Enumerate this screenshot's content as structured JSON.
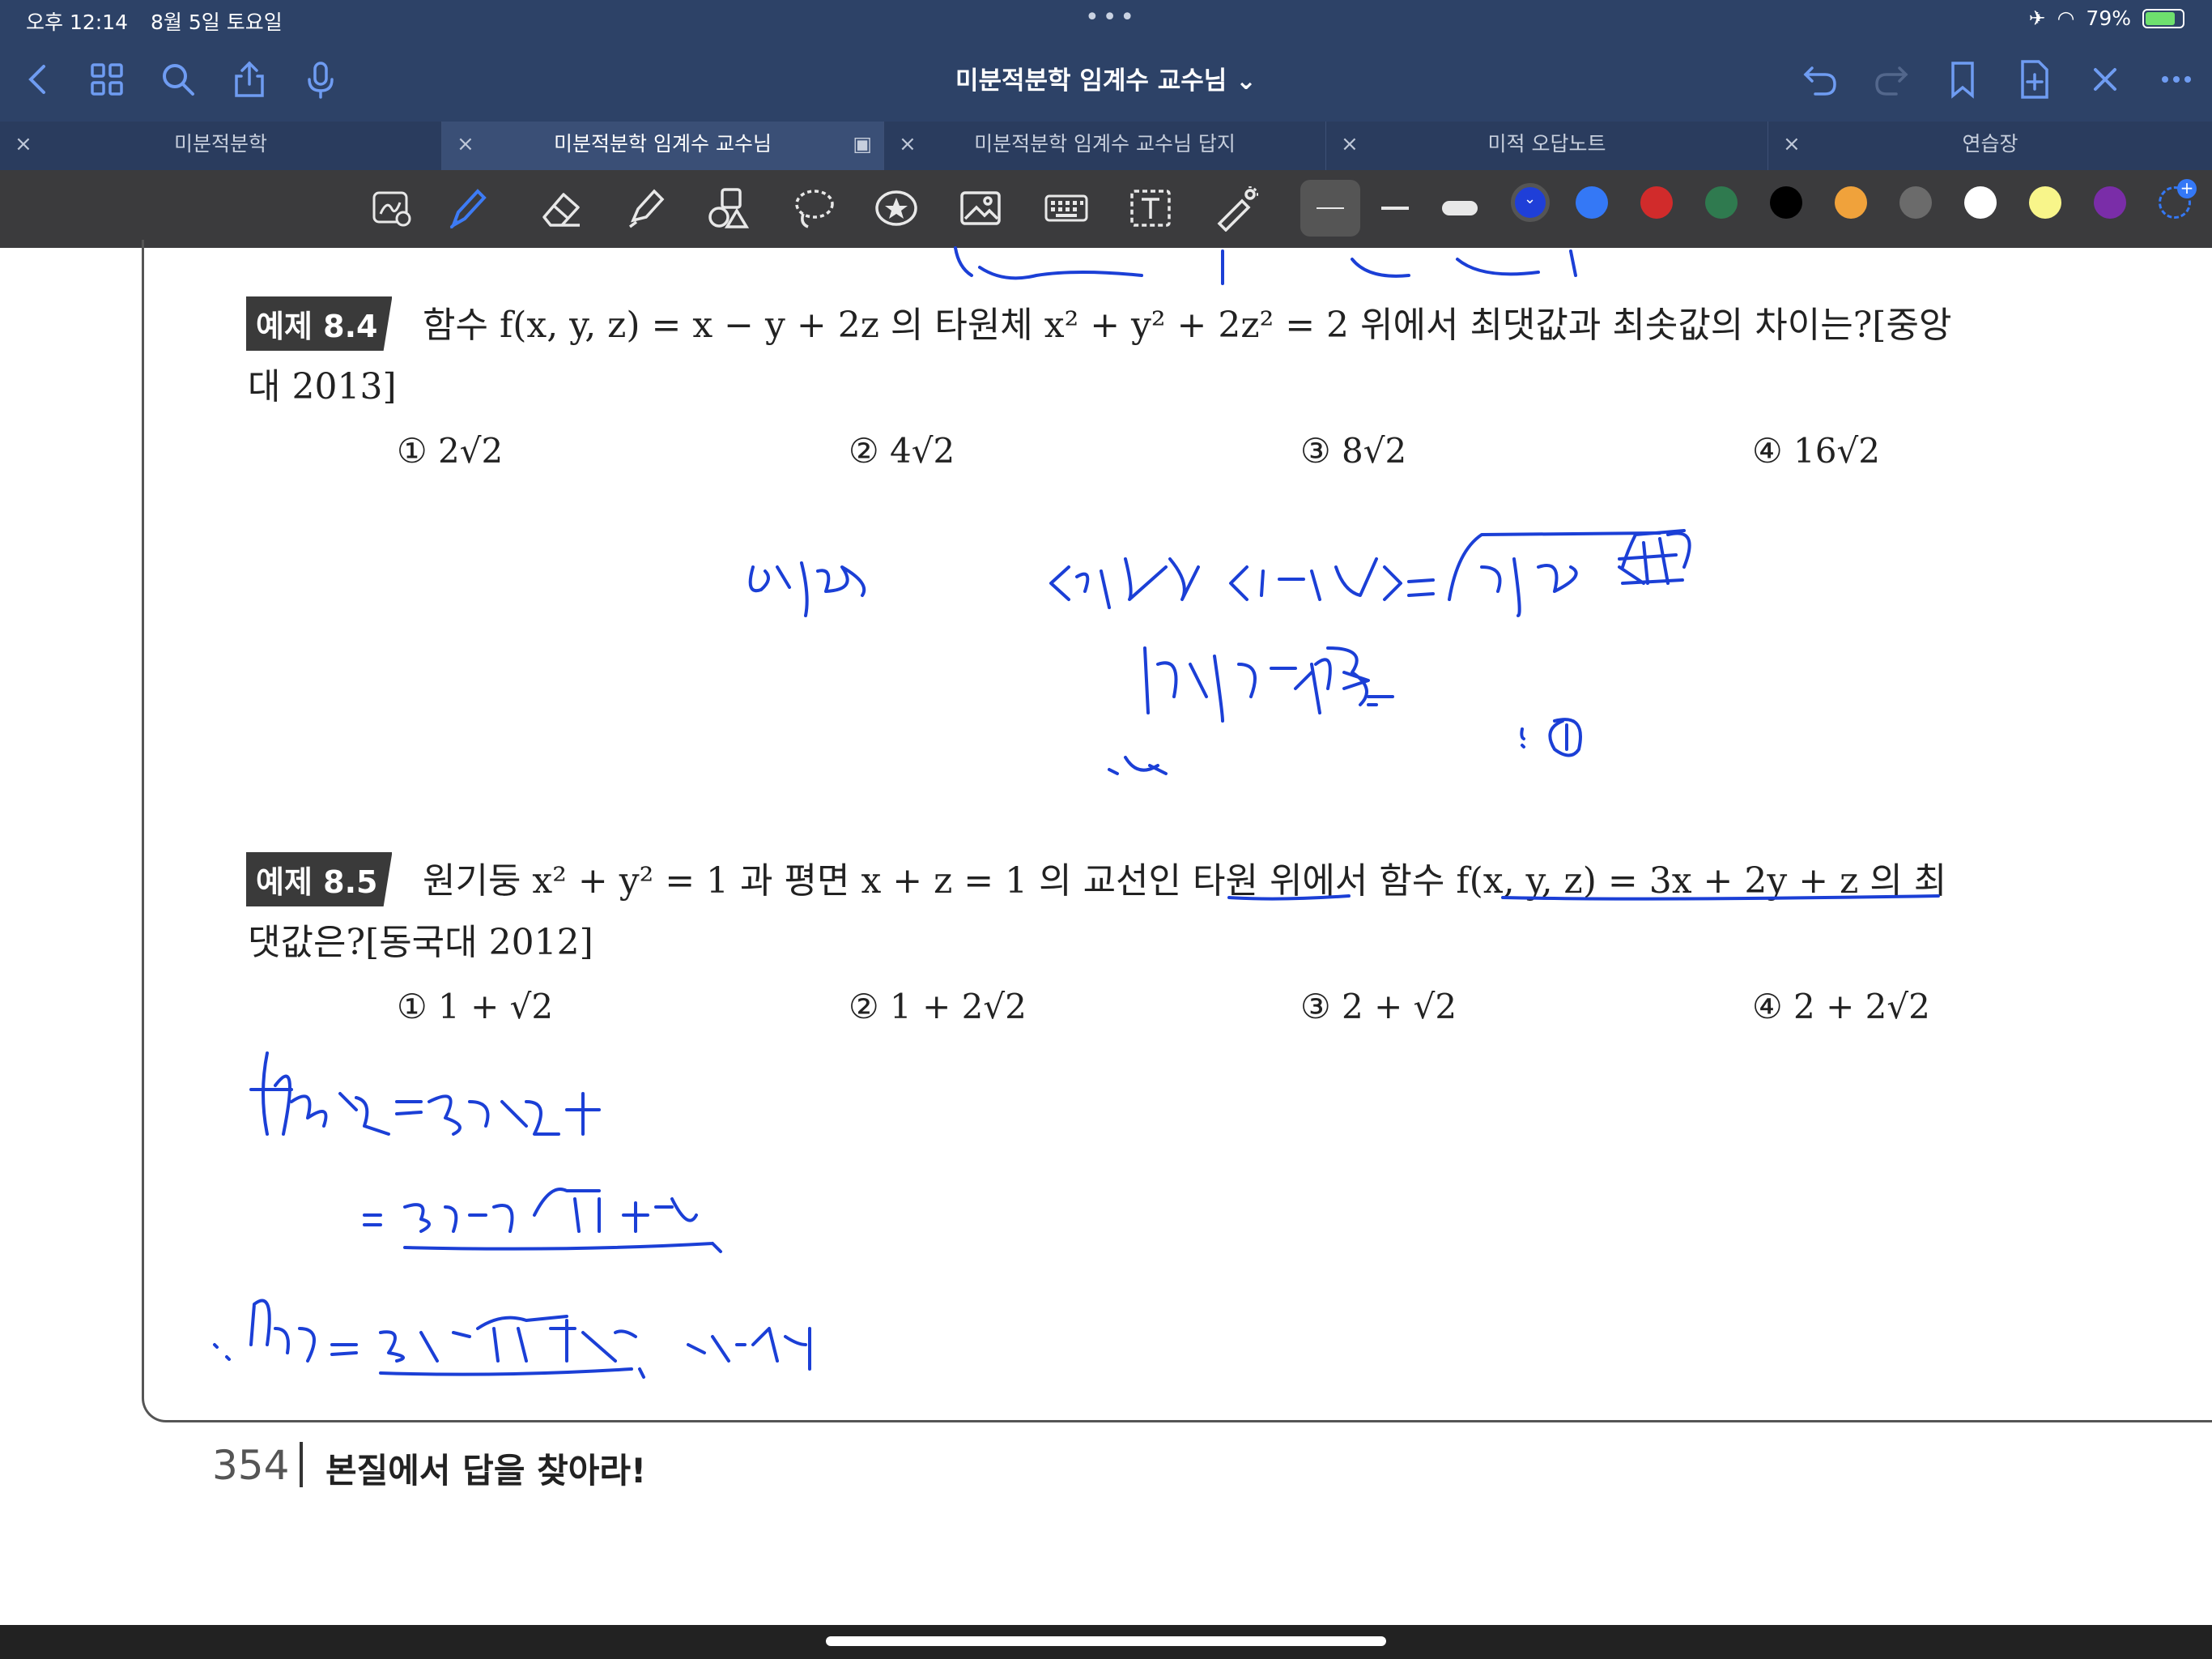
{
  "status": {
    "time": "오후 12:14",
    "date": "8월 5일 토요일",
    "battery": "79%"
  },
  "nav": {
    "title": "미분적분학 임계수 교수님 ⌄"
  },
  "tabs": [
    {
      "label": "미분적분학"
    },
    {
      "label": "미분적분학 임계수 교수님"
    },
    {
      "label": "미분적분학 임계수 교수님 답지"
    },
    {
      "label": "미적 오답노트"
    },
    {
      "label": "연습장"
    }
  ],
  "colors": {
    "accent": "#2f5fdc",
    "ink": "#1b3fd6",
    "topbar": "#2d4267",
    "toolbar": "#3b3b3d"
  },
  "palette": [
    "#1f3fd8",
    "#3478f6",
    "#d12b2b",
    "#2f7a4f",
    "#000000",
    "#f0a23b",
    "#6b6b6b",
    "#ffffff",
    "#f8f58a",
    "#7a2da8"
  ],
  "ex84": {
    "label": "예제 8.4",
    "line1": "함수 f(x, y, z) = x − y + 2z 의 타원체 x² + y² + 2z² = 2  위에서 최댓값과 최솟값의 차이는?[중앙",
    "line2": "대 2013]",
    "choices": [
      "① 2√2",
      "② 4√2",
      "③ 8√2",
      "④ 16√2"
    ]
  },
  "ex85": {
    "label": "예제 8.5",
    "line1": "원기둥 x² + y² = 1 과 평면 x + z = 1 의 교선인 타원 위에서 함수 f(x, y, z) = 3x + 2y + z 의 최",
    "line2": "댓값은?[동국대 2012]",
    "choices": [
      "① 1 + √2",
      "② 1 + 2√2",
      "③ 2 + √2",
      "④ 2 + 2√2"
    ]
  },
  "footer": {
    "page": "354",
    "slogan": "본질에서 답을 찾아라!"
  }
}
